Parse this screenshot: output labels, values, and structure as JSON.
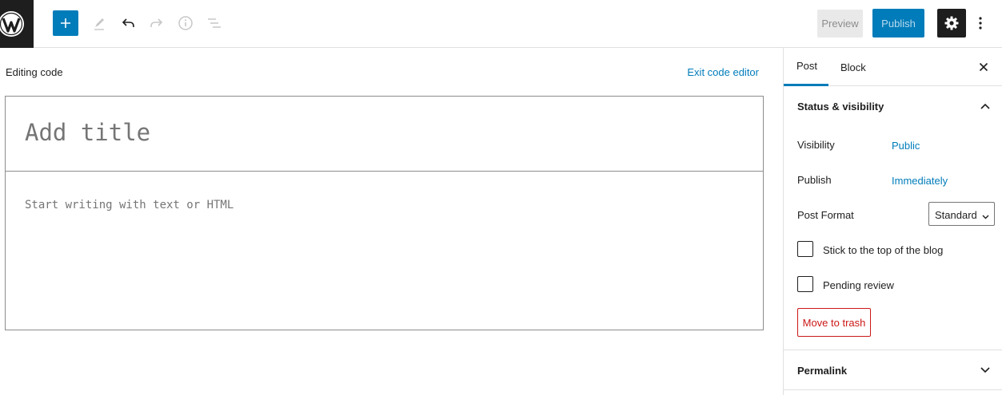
{
  "toolbar": {
    "logo_icon": "wordpress-logo",
    "add_block_icon": "plus-icon",
    "tools_icon": "pencil-icon",
    "undo_icon": "undo-icon",
    "redo_icon": "redo-icon",
    "details_icon": "info-icon",
    "outline_icon": "list-view-icon",
    "preview_label": "Preview",
    "publish_label": "Publish",
    "settings_icon": "gear-icon",
    "more_icon": "more-vertical-icon"
  },
  "editor": {
    "mode_label": "Editing code",
    "exit_label": "Exit code editor",
    "title_placeholder": "Add title",
    "content_placeholder": "Start writing with text or HTML"
  },
  "sidebar": {
    "tabs": [
      {
        "label": "Post",
        "active": true
      },
      {
        "label": "Block",
        "active": false
      }
    ],
    "status_panel": {
      "title": "Status & visibility",
      "visibility_label": "Visibility",
      "visibility_value": "Public",
      "publish_label": "Publish",
      "publish_value": "Immediately",
      "format_label": "Post Format",
      "format_value": "Standard",
      "sticky_label": "Stick to the top of the blog",
      "sticky_checked": false,
      "pending_label": "Pending review",
      "pending_checked": false,
      "trash_label": "Move to trash"
    },
    "permalink_panel": {
      "title": "Permalink"
    }
  },
  "colors": {
    "accent": "#007cba",
    "danger": "#cc1818",
    "dark": "#1e1e1e",
    "border": "#e0e0e0"
  }
}
